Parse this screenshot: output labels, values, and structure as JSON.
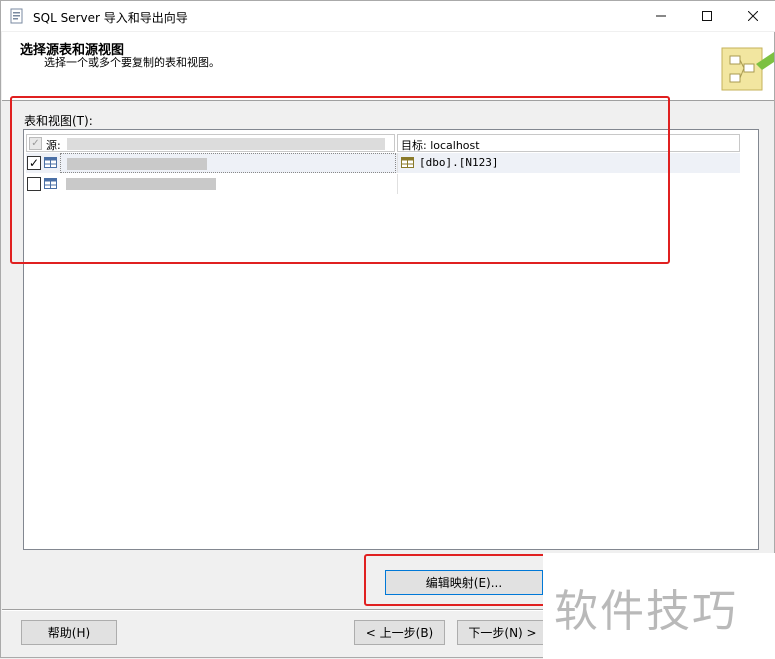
{
  "window": {
    "title": "SQL Server 导入和导出向导",
    "icons": {
      "app": "wizard-app-icon",
      "minimize": "minimize-icon",
      "maximize": "maximize-icon",
      "close": "close-icon"
    }
  },
  "header": {
    "title": "选择源表和源视图",
    "subtitle": "选择一个或多个要复制的表和视图。",
    "logo_icon": "wizard-logo-icon"
  },
  "tables_list": {
    "label": "表和视图(T):",
    "columns": {
      "source": "源:",
      "destination": "目标: localhost"
    },
    "rows": [
      {
        "checked": true,
        "source": "",
        "destination": "[dbo].[N123]"
      },
      {
        "checked": false,
        "source": "",
        "destination": ""
      }
    ]
  },
  "buttons": {
    "edit_mappings": "编辑映射(E)...",
    "help": "帮助(H)",
    "back": "< 上一步(B)",
    "next": "下一步(N) >"
  },
  "watermark": "软件技巧",
  "colors": {
    "highlight": "#e02020",
    "accent": "#0078d7"
  }
}
